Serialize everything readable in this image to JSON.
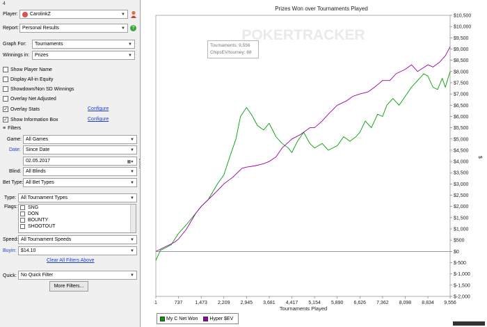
{
  "corner_num": "4",
  "player": {
    "label": "Player:",
    "value": "CarolinkZ"
  },
  "report": {
    "label": "Report:",
    "value": "Personal Results"
  },
  "graph_for": {
    "label": "Graph For:",
    "value": "Tournaments"
  },
  "winnings_in": {
    "label": "Winnings in:",
    "value": "Prizes"
  },
  "options": [
    {
      "label": "Show Player Name",
      "checked": false,
      "configure": ""
    },
    {
      "label": "Display All-in Equity",
      "checked": false,
      "configure": ""
    },
    {
      "label": "Showdown/Non SD Winnings",
      "checked": false,
      "configure": ""
    },
    {
      "label": "Overlay Net Adjusted",
      "checked": false,
      "configure": ""
    },
    {
      "label": "Overlay Stats",
      "checked": true,
      "configure": "Configure"
    },
    {
      "label": "Show Information Box",
      "checked": true,
      "configure": "Configure"
    }
  ],
  "filters_header": "Filters",
  "filters": {
    "game_label": "Game:",
    "game_value": "All Games",
    "date_label": "Date:",
    "date_value": "Since Date",
    "date_input": "02.05.2017",
    "blind_label": "Blind:",
    "blind_value": "All Blinds",
    "bet_type_label": "Bet Type:",
    "bet_type_value": "All Bet Types",
    "type_label": "Type:",
    "type_value": "All Tournament Types",
    "flags_label": "Flags:",
    "flags": [
      "SNG",
      "DON",
      "BOUNTY",
      "SHOOTOUT"
    ],
    "speed_label": "Speed:",
    "speed_value": "All Tournament Speeds",
    "buyin_label": "Buyin:",
    "buyin_value": "$14.10",
    "clear_all": "Clear All Filters Above"
  },
  "quick": {
    "label": "Quick:",
    "value": "No Quick Filter"
  },
  "more_filters": "More Filters...",
  "tooltip": {
    "line1": "Tournaments: 9,556",
    "line2": "ChipsEV/tourney: 68"
  },
  "watermark": "POKERTRACKER",
  "chart_data": {
    "type": "line",
    "title": "Prizes Won over Tournaments Played",
    "xlabel": "Tournaments Played",
    "ylabel": "$",
    "xlim": [
      1,
      9556
    ],
    "ylim": [
      -2000,
      10500
    ],
    "x_ticks": [
      1,
      737,
      1473,
      2209,
      2945,
      3681,
      4417,
      5154,
      5890,
      6626,
      7362,
      8098,
      8834,
      9556
    ],
    "x_tick_labels": [
      "1",
      "737",
      "1,473",
      "2,209",
      "2,945",
      "3,681",
      "4,417",
      "5,154",
      "5,890",
      "6,626",
      "7,362",
      "8,098",
      "8,834",
      "9,556"
    ],
    "y_ticks": [
      10500,
      10000,
      9500,
      9000,
      8500,
      8000,
      7500,
      7000,
      6500,
      6000,
      5500,
      5000,
      4500,
      4000,
      3500,
      3000,
      2500,
      2000,
      1500,
      1000,
      500,
      0,
      -500,
      -1000,
      -1500,
      -2000
    ],
    "y_tick_labels": [
      "$10,500",
      "$10,000",
      "$9,500",
      "$9,000",
      "$8,500",
      "$8,000",
      "$7,500",
      "$7,000",
      "$6,500",
      "$6,000",
      "$5,500",
      "$5,000",
      "$4,500",
      "$4,000",
      "$3,500",
      "$3,000",
      "$2,500",
      "$2,000",
      "$1,500",
      "$1,000",
      "$500",
      "$0",
      "$-500",
      "$-1,000",
      "$-1,500",
      "$-2,000"
    ],
    "grid": false,
    "legend_position": "bottom-left",
    "series": [
      {
        "name": "My C Net Won",
        "color": "#00a000",
        "x": [
          1,
          150,
          300,
          500,
          737,
          1000,
          1300,
          1473,
          1700,
          2000,
          2209,
          2400,
          2600,
          2750,
          2945,
          3100,
          3300,
          3500,
          3681,
          3900,
          4100,
          4300,
          4417,
          4600,
          4800,
          5000,
          5154,
          5400,
          5600,
          5890,
          6100,
          6300,
          6500,
          6626,
          6800,
          7000,
          7200,
          7362,
          7500,
          7700,
          7900,
          8098,
          8300,
          8500,
          8700,
          8834,
          9000,
          9150,
          9300,
          9400,
          9556
        ],
        "y": [
          -400,
          50,
          150,
          300,
          800,
          1200,
          1700,
          2000,
          2300,
          3000,
          3400,
          4200,
          5000,
          6000,
          6400,
          6100,
          5600,
          5400,
          5700,
          5100,
          4800,
          4600,
          4400,
          4900,
          5300,
          4800,
          4600,
          4800,
          4500,
          4700,
          5100,
          4900,
          5100,
          5300,
          5800,
          5500,
          6100,
          6000,
          6500,
          6800,
          6500,
          6900,
          7300,
          7600,
          7900,
          7800,
          7300,
          7200,
          7700,
          7300,
          8000
        ]
      },
      {
        "name": "Hyper $EV",
        "color": "#9b00a0",
        "x": [
          1,
          300,
          600,
          737,
          1000,
          1300,
          1473,
          1700,
          2000,
          2209,
          2500,
          2800,
          2945,
          3200,
          3500,
          3681,
          3900,
          4100,
          4417,
          4700,
          5000,
          5154,
          5400,
          5600,
          5890,
          6200,
          6400,
          6626,
          6900,
          7100,
          7362,
          7600,
          7800,
          8098,
          8300,
          8500,
          8834,
          9000,
          9200,
          9400,
          9556
        ],
        "y": [
          0,
          200,
          400,
          550,
          1000,
          1700,
          2000,
          2300,
          2700,
          3000,
          3300,
          3700,
          3750,
          3800,
          3900,
          4000,
          4200,
          4600,
          5000,
          5200,
          5500,
          5500,
          5800,
          6100,
          6500,
          6700,
          6900,
          7000,
          7100,
          7300,
          7600,
          7600,
          7900,
          8100,
          8300,
          8000,
          8300,
          8200,
          8400,
          8700,
          9100
        ]
      }
    ]
  }
}
